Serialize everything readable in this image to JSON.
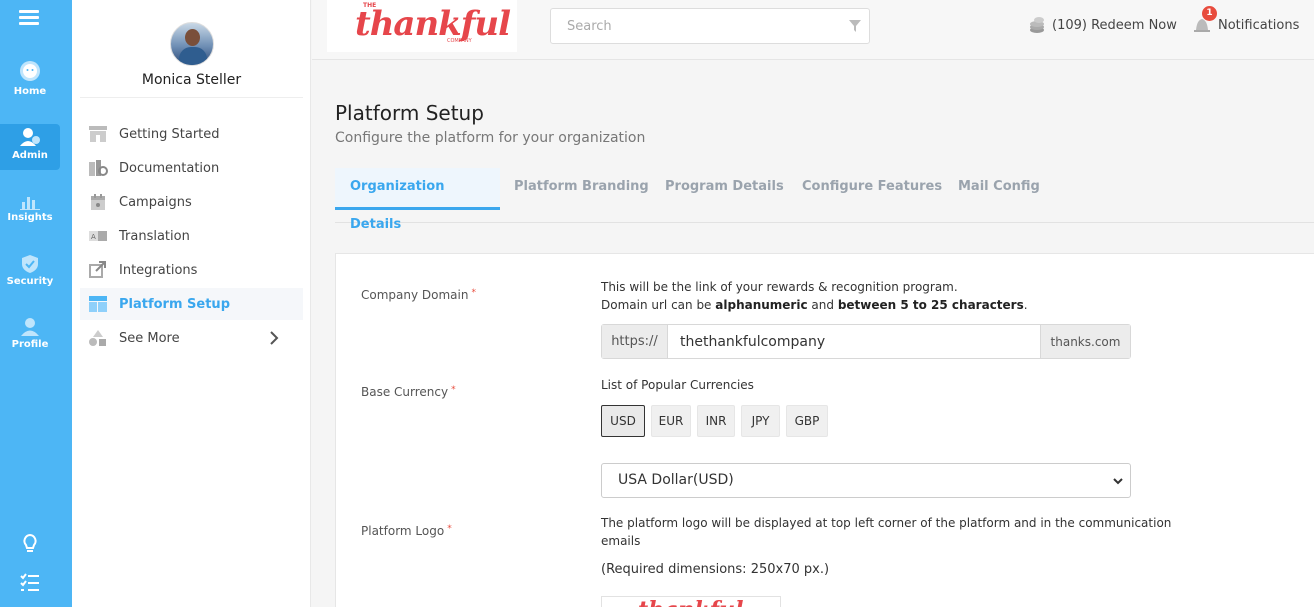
{
  "rail": {
    "items": [
      {
        "label": "Home"
      },
      {
        "label": "Admin"
      },
      {
        "label": "Insights"
      },
      {
        "label": "Security"
      },
      {
        "label": "Profile"
      }
    ]
  },
  "sidebar": {
    "user_name": "Monica Steller",
    "items": [
      {
        "label": "Getting Started"
      },
      {
        "label": "Documentation"
      },
      {
        "label": "Campaigns"
      },
      {
        "label": "Translation"
      },
      {
        "label": "Integrations"
      },
      {
        "label": "Platform Setup"
      },
      {
        "label": "See More"
      }
    ]
  },
  "topbar": {
    "brand": "thankful",
    "brand_small": "THE",
    "brand_sub": "COMPANY",
    "search_placeholder": "Search",
    "redeem": "(109) Redeem Now",
    "notifications_label": "Notifications",
    "notifications_count": "1"
  },
  "main": {
    "title": "Platform Setup",
    "subtitle": "Configure the platform for your organization",
    "tabs": [
      {
        "label": "Organization Details"
      },
      {
        "label": "Platform Branding"
      },
      {
        "label": "Program Details"
      },
      {
        "label": "Configure Features"
      },
      {
        "label": "Mail Config"
      }
    ]
  },
  "form": {
    "domain_label": "Company Domain",
    "domain_help_1": "This will be the link of your rewards & recognition program.",
    "domain_help_2a": "Domain url can be ",
    "domain_help_2b": "alphanumeric",
    "domain_help_2c": " and ",
    "domain_help_2d": "between 5 to 25 characters",
    "domain_help_2e": ".",
    "url_prefix": "https://",
    "url_value": "thethankfulcompany",
    "url_suffix": "thanks.com",
    "currency_label": "Base Currency",
    "currency_help": "List of Popular Currencies",
    "currencies": [
      "USD",
      "EUR",
      "INR",
      "JPY",
      "GBP"
    ],
    "currency_selected": "USA Dollar(USD)",
    "logo_label": "Platform Logo",
    "logo_help_1": "The platform logo will be displayed at top left corner of the platform and in the communication",
    "logo_help_2": "emails",
    "logo_dims": "(Required dimensions: 250x70 px.)",
    "logo_preview": "thankful"
  },
  "colors": {
    "rail": "#4db6f5",
    "accent": "#3aa7ee",
    "brand": "#e6464b",
    "badge": "#e84c3d"
  }
}
